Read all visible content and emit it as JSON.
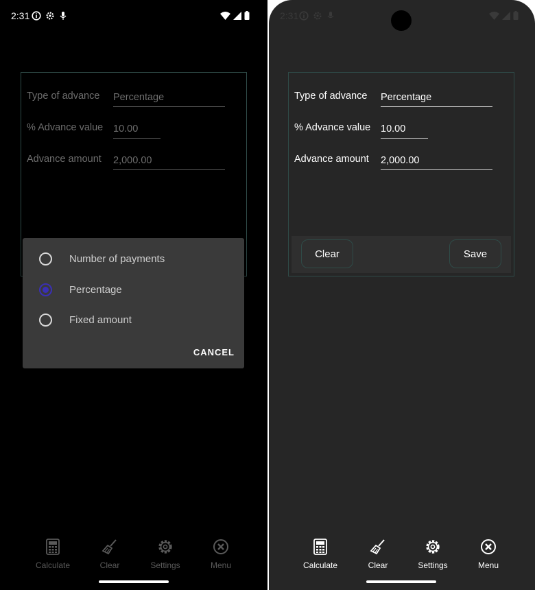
{
  "status_bar": {
    "time": "2:31"
  },
  "form": {
    "type_label": "Type of advance",
    "type_value": "Percentage",
    "value_label": "% Advance value",
    "value_value": "10.00",
    "amount_label": "Advance amount",
    "amount_value": "2,000.00"
  },
  "buttons": {
    "clear": "Clear",
    "save": "Save"
  },
  "dialog": {
    "options": [
      {
        "label": "Number of payments",
        "selected": false
      },
      {
        "label": "Percentage",
        "selected": true
      },
      {
        "label": "Fixed amount",
        "selected": false
      }
    ],
    "cancel": "Cancel"
  },
  "nav": {
    "items": [
      {
        "label": "Calculate",
        "icon": "calculator-icon"
      },
      {
        "label": "Clear",
        "icon": "broom-icon"
      },
      {
        "label": "Settings",
        "icon": "gear-icon"
      },
      {
        "label": "Menu",
        "icon": "close-circle-icon"
      }
    ]
  },
  "colors": {
    "accent_radio": "#3a2fb5",
    "card_border": "#2f4b48"
  }
}
